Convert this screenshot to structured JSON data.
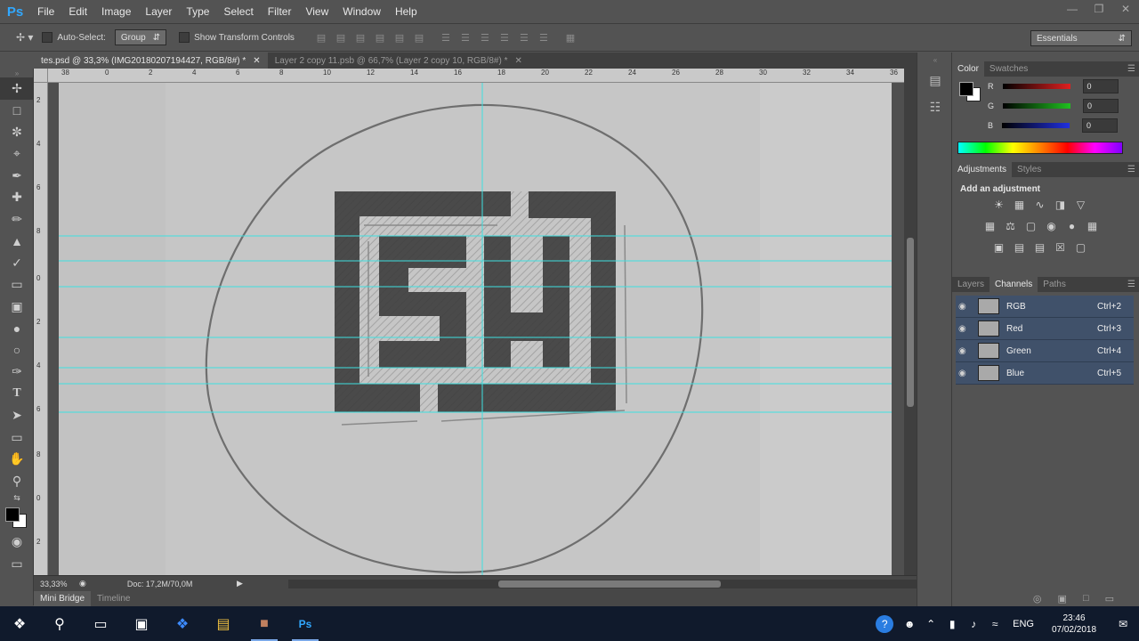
{
  "app": {
    "logo": "Ps"
  },
  "menu": [
    "File",
    "Edit",
    "Image",
    "Layer",
    "Type",
    "Select",
    "Filter",
    "View",
    "Window",
    "Help"
  ],
  "window_controls": [
    "minimize-icon",
    "restore-icon",
    "close-icon"
  ],
  "options_bar": {
    "auto_select_label": "Auto-Select:",
    "auto_select_value": "Group",
    "transform_label": "Show Transform Controls",
    "workspace": "Essentials"
  },
  "doc_tabs": [
    {
      "label": "tes.psd @ 33,3% (IMG20180207194427, RGB/8#) *",
      "active": true
    },
    {
      "label": "Layer 2 copy 11.psb @ 66,7% (Layer 2 copy 10, RGB/8#) *",
      "active": false
    }
  ],
  "ruler_top": [
    "0",
    "2",
    "4",
    "6",
    "8",
    "10",
    "12",
    "14",
    "16",
    "18",
    "20",
    "22",
    "24",
    "26",
    "28",
    "30",
    "32",
    "34",
    "36",
    "38"
  ],
  "ruler_left": [
    "2",
    "4",
    "6",
    "8",
    "0",
    "2",
    "4",
    "6",
    "8",
    "0",
    "2"
  ],
  "status": {
    "zoom": "33,33%",
    "doc": "Doc: 17,2M/70,0M"
  },
  "bottom_tabs": [
    "Mini Bridge",
    "Timeline"
  ],
  "color_panel": {
    "tabs": [
      "Color",
      "Swatches"
    ],
    "channels": [
      {
        "label": "R",
        "value": "0",
        "color": "#e02020"
      },
      {
        "label": "G",
        "value": "0",
        "color": "#20c020"
      },
      {
        "label": "B",
        "value": "0",
        "color": "#2030e0"
      }
    ]
  },
  "adjustments_panel": {
    "tabs": [
      "Adjustments",
      "Styles"
    ],
    "title": "Add an adjustment"
  },
  "layers_panel": {
    "tabs": [
      "Layers",
      "Channels",
      "Paths"
    ],
    "active_tab": "Channels",
    "channels": [
      {
        "name": "RGB",
        "shortcut": "Ctrl+2"
      },
      {
        "name": "Red",
        "shortcut": "Ctrl+3"
      },
      {
        "name": "Green",
        "shortcut": "Ctrl+4"
      },
      {
        "name": "Blue",
        "shortcut": "Ctrl+5"
      }
    ]
  },
  "taskbar": {
    "lang": "ENG",
    "time": "23:46",
    "date": "07/02/2018"
  }
}
